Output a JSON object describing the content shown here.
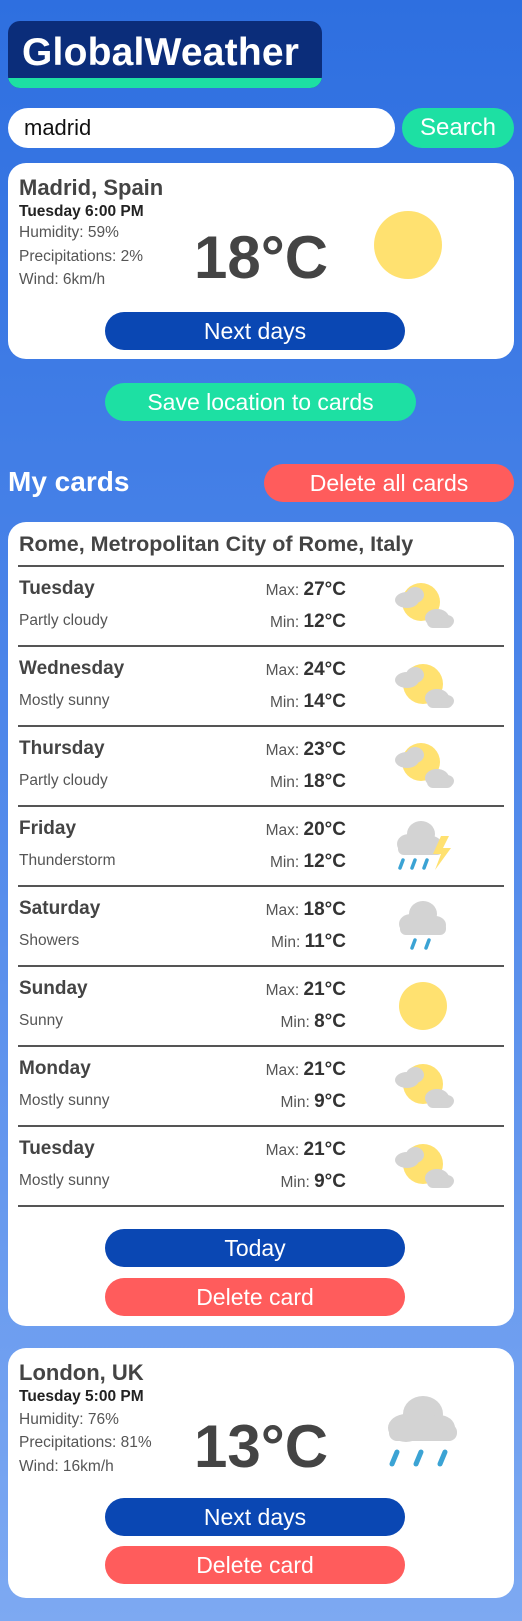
{
  "app": {
    "title": "GlobalWeather",
    "colors": {
      "primary": "#0a47b3",
      "accent": "#1de0a3",
      "danger": "#ff5c5c",
      "logo_bg": "#0b2d7a"
    }
  },
  "search": {
    "value": "madrid",
    "button_label": "Search"
  },
  "current": {
    "location": "Madrid, Spain",
    "time": "Tuesday 6:00 PM",
    "humidity": "Humidity: 59%",
    "precipitation": "Precipitations: 2%",
    "wind": "Wind: 6km/h",
    "temperature": "18°C",
    "icon": "sun-icon",
    "next_days_label": "Next days"
  },
  "save_location_label": "Save location to cards",
  "my_cards": {
    "heading": "My cards",
    "delete_all_label": "Delete all cards"
  },
  "rome_card": {
    "location": "Rome, Metropolitan City of Rome, Italy",
    "max_label": "Max:",
    "min_label": "Min:",
    "forecast": [
      {
        "day": "Tuesday",
        "desc": "Partly cloudy",
        "max": "27°C",
        "min": "12°C",
        "icon": "partly-cloudy-icon"
      },
      {
        "day": "Wednesday",
        "desc": "Mostly sunny",
        "max": "24°C",
        "min": "14°C",
        "icon": "mostly-sunny-icon"
      },
      {
        "day": "Thursday",
        "desc": "Partly cloudy",
        "max": "23°C",
        "min": "18°C",
        "icon": "partly-cloudy-icon"
      },
      {
        "day": "Friday",
        "desc": "Thunderstorm",
        "max": "20°C",
        "min": "12°C",
        "icon": "thunderstorm-icon"
      },
      {
        "day": "Saturday",
        "desc": "Showers",
        "max": "18°C",
        "min": "11°C",
        "icon": "showers-icon"
      },
      {
        "day": "Sunday",
        "desc": "Sunny",
        "max": "21°C",
        "min": "8°C",
        "icon": "sun-icon"
      },
      {
        "day": "Monday",
        "desc": "Mostly sunny",
        "max": "21°C",
        "min": "9°C",
        "icon": "mostly-sunny-icon"
      },
      {
        "day": "Tuesday",
        "desc": "Mostly sunny",
        "max": "21°C",
        "min": "9°C",
        "icon": "mostly-sunny-icon"
      }
    ],
    "today_label": "Today",
    "delete_label": "Delete card"
  },
  "london_card": {
    "location": "London, UK",
    "time": "Tuesday 5:00 PM",
    "humidity": "Humidity: 76%",
    "precipitation": "Precipitations: 81%",
    "wind": "Wind: 16km/h",
    "temperature": "13°C",
    "icon": "rain-icon",
    "next_days_label": "Next days",
    "delete_label": "Delete card"
  }
}
